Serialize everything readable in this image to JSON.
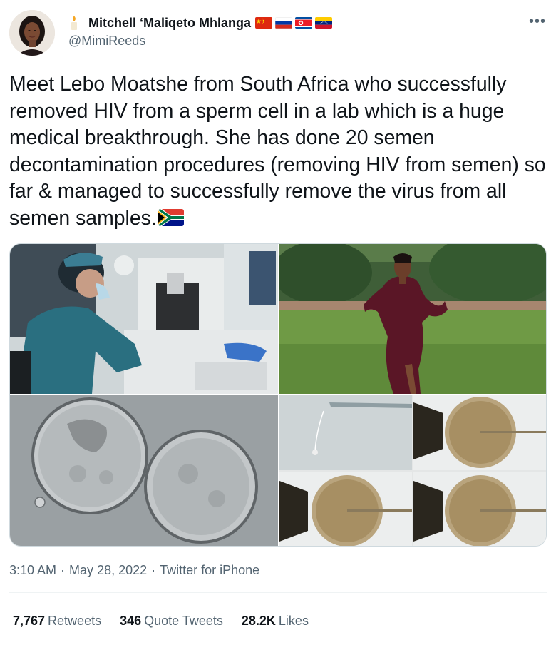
{
  "author": {
    "display_name": "Mitchell ‘Maliqeto Mhlanga",
    "handle": "@MimiReeds"
  },
  "tweet": {
    "text": "Meet Lebo Moatshe from South Africa who successfully removed HIV from a sperm cell in a lab which is a huge medical breakthrough. She has done 20 semen decontamination procedures (removing HIV from semen) so far & managed to successfully remove the virus from all semen samples."
  },
  "meta": {
    "time": "3:10 AM",
    "separator_1": "·",
    "date": "May 28, 2022",
    "separator_2": "·",
    "source": "Twitter for iPhone"
  },
  "stats": {
    "retweets_count": "7,767",
    "retweets_label": "Retweets",
    "quotes_count": "346",
    "quotes_label": "Quote Tweets",
    "likes_count": "28.2K",
    "likes_label": "Likes"
  },
  "icons": {
    "more": "more-horizontal-icon",
    "name_emoji": "candle-icon",
    "name_flags": [
      "china-flag-icon",
      "russia-flag-icon",
      "north-korea-flag-icon",
      "venezuela-flag-icon"
    ],
    "text_flag": "south-africa-flag-icon"
  },
  "colors": {
    "text_primary": "#0f1419",
    "text_secondary": "#536471",
    "border": "#cfd9de"
  }
}
